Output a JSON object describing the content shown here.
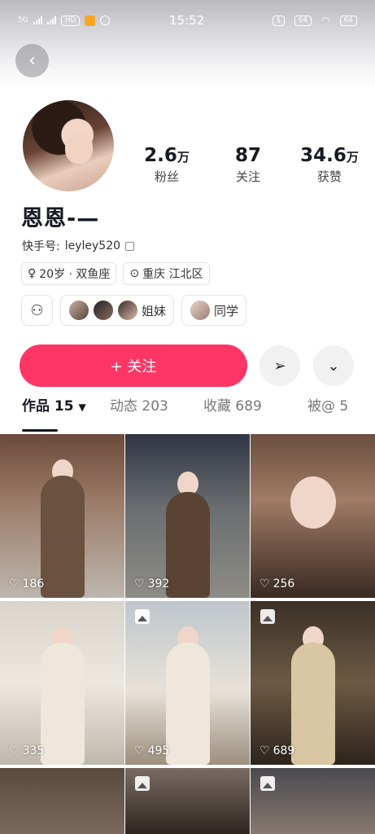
{
  "status_bar": {
    "network": "5G",
    "time": "15:52",
    "battery": "64"
  },
  "profile": {
    "stats": [
      {
        "value": "2.6",
        "unit": "万",
        "label": "粉丝"
      },
      {
        "value": "87",
        "unit": "",
        "label": "关注"
      },
      {
        "value": "34.6",
        "unit": "万",
        "label": "获赞"
      }
    ],
    "username": "恩恩-—",
    "kuaishou_id_label": "快手号:",
    "kuaishou_id": "leyley520",
    "age_sign": "20岁 · 双鱼座",
    "location": "重庆 江北区"
  },
  "chips": {
    "sisters_label": "姐妹",
    "classmates_label": "同学"
  },
  "actions": {
    "follow_label": "+ 关注"
  },
  "tabs": [
    {
      "label": "作品 15"
    },
    {
      "label": "动态 203"
    },
    {
      "label": "收藏 689"
    },
    {
      "label": "被@ 5"
    }
  ],
  "grid": [
    {
      "likes": "186"
    },
    {
      "likes": "392"
    },
    {
      "likes": "256"
    },
    {
      "likes": "335"
    },
    {
      "likes": "495"
    },
    {
      "likes": "689"
    },
    {
      "likes": ""
    },
    {
      "likes": ""
    },
    {
      "likes": ""
    }
  ],
  "colors": {
    "accent": "#fe3666",
    "text": "#161823"
  }
}
